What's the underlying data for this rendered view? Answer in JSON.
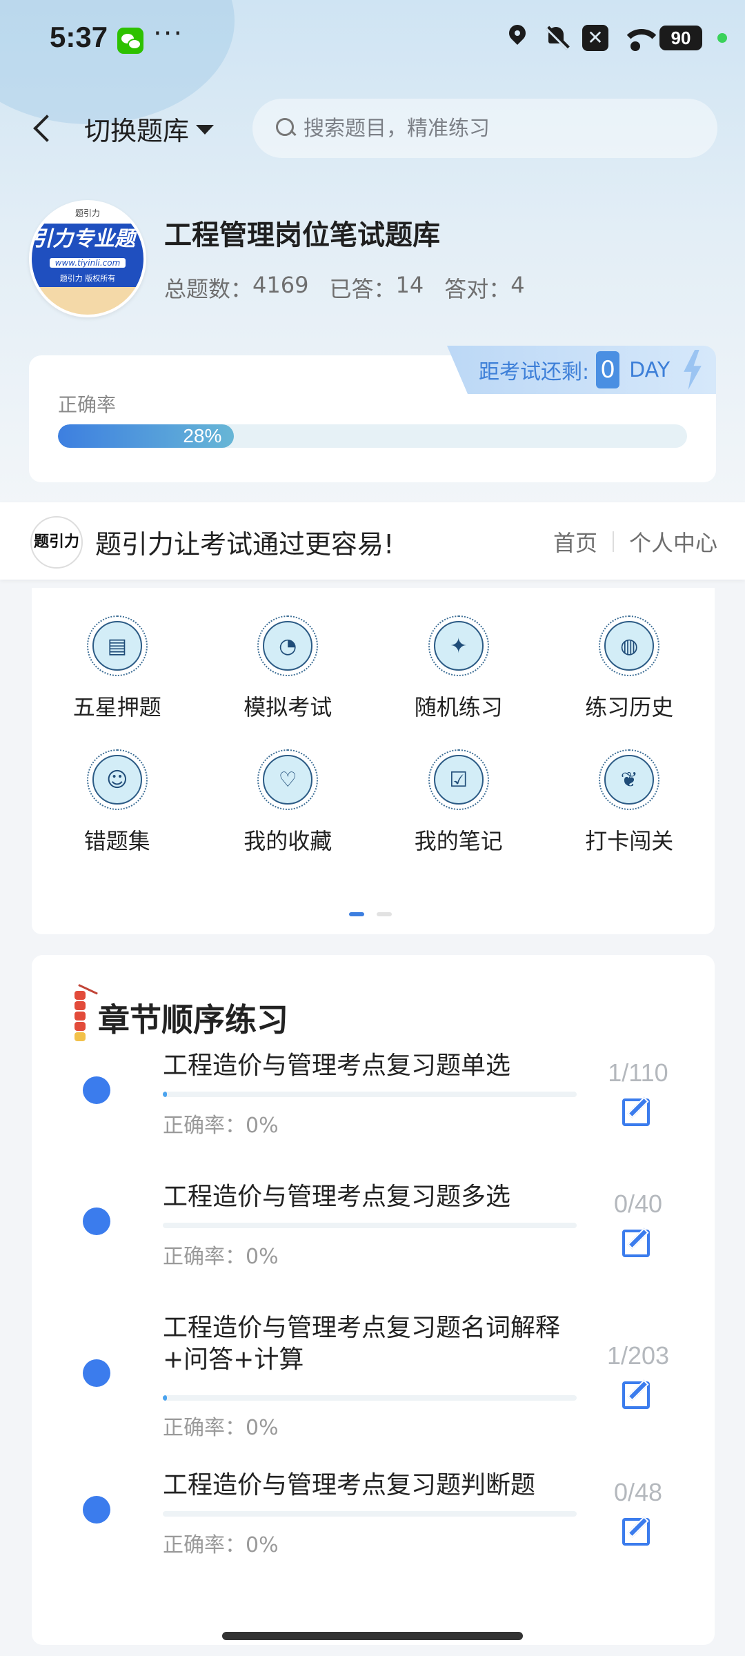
{
  "status_bar": {
    "time": "5:37",
    "dots": "···",
    "battery": "90",
    "x_badge": "✕"
  },
  "nav": {
    "switch_label": "切换题库",
    "search_placeholder": "搜索题目，精准练习"
  },
  "bank": {
    "title": "工程管理岗位笔试题库",
    "logo": {
      "top": "题引力",
      "big": "引力专业题",
      "url": "www.tiyinli.com",
      "copyright": "题引力 版权所有"
    },
    "stats": [
      {
        "label": "总题数：",
        "value": "4169"
      },
      {
        "label": "已答：",
        "value": "14"
      },
      {
        "label": "答对：",
        "value": "4"
      }
    ]
  },
  "accuracy": {
    "label": "正确率",
    "percent_text": "28%",
    "percent_value": 28,
    "countdown_label": "距考试还剩:",
    "countdown_days": "0",
    "countdown_unit": "DAY"
  },
  "slogan": {
    "logo_text": "题引力",
    "text": "题引力让考试通过更容易!",
    "links": [
      "首页",
      "个人中心"
    ]
  },
  "menu": {
    "items": [
      {
        "label": "五星押题",
        "icon": "id-card-icon",
        "glyph": "▤"
      },
      {
        "label": "模拟考试",
        "icon": "gauge-icon",
        "glyph": "◔"
      },
      {
        "label": "随机练习",
        "icon": "network-icon",
        "glyph": "✦"
      },
      {
        "label": "练习历史",
        "icon": "globe-icon",
        "glyph": "◍"
      },
      {
        "label": "错题集",
        "icon": "head-icon",
        "glyph": "☺"
      },
      {
        "label": "我的收藏",
        "icon": "heart-icon",
        "glyph": "♡"
      },
      {
        "label": "我的笔记",
        "icon": "note-check-icon",
        "glyph": "☑"
      },
      {
        "label": "打卡闯关",
        "icon": "leaf-icon",
        "glyph": "❦"
      }
    ],
    "page_count": 2,
    "active_page": 0
  },
  "chapters": {
    "title": "章节顺序练习",
    "items": [
      {
        "name": "工程造价与管理考点复习题单选",
        "accuracy": "正确率：0%",
        "count": "1/110",
        "progress": 0.009
      },
      {
        "name": "工程造价与管理考点复习题多选",
        "accuracy": "正确率：0%",
        "count": "0/40",
        "progress": 0
      },
      {
        "name": "工程造价与管理考点复习题名词解释+问答+计算",
        "accuracy": "正确率：0%",
        "count": "1/203",
        "progress": 0.005
      },
      {
        "name": "工程造价与管理考点复习题判断题",
        "accuracy": "正确率：0%",
        "count": "0/48",
        "progress": 0
      }
    ]
  },
  "colors": {
    "accent": "#3b7ced",
    "progress_start": "#3d7fe0",
    "progress_end": "#67b6d6"
  }
}
